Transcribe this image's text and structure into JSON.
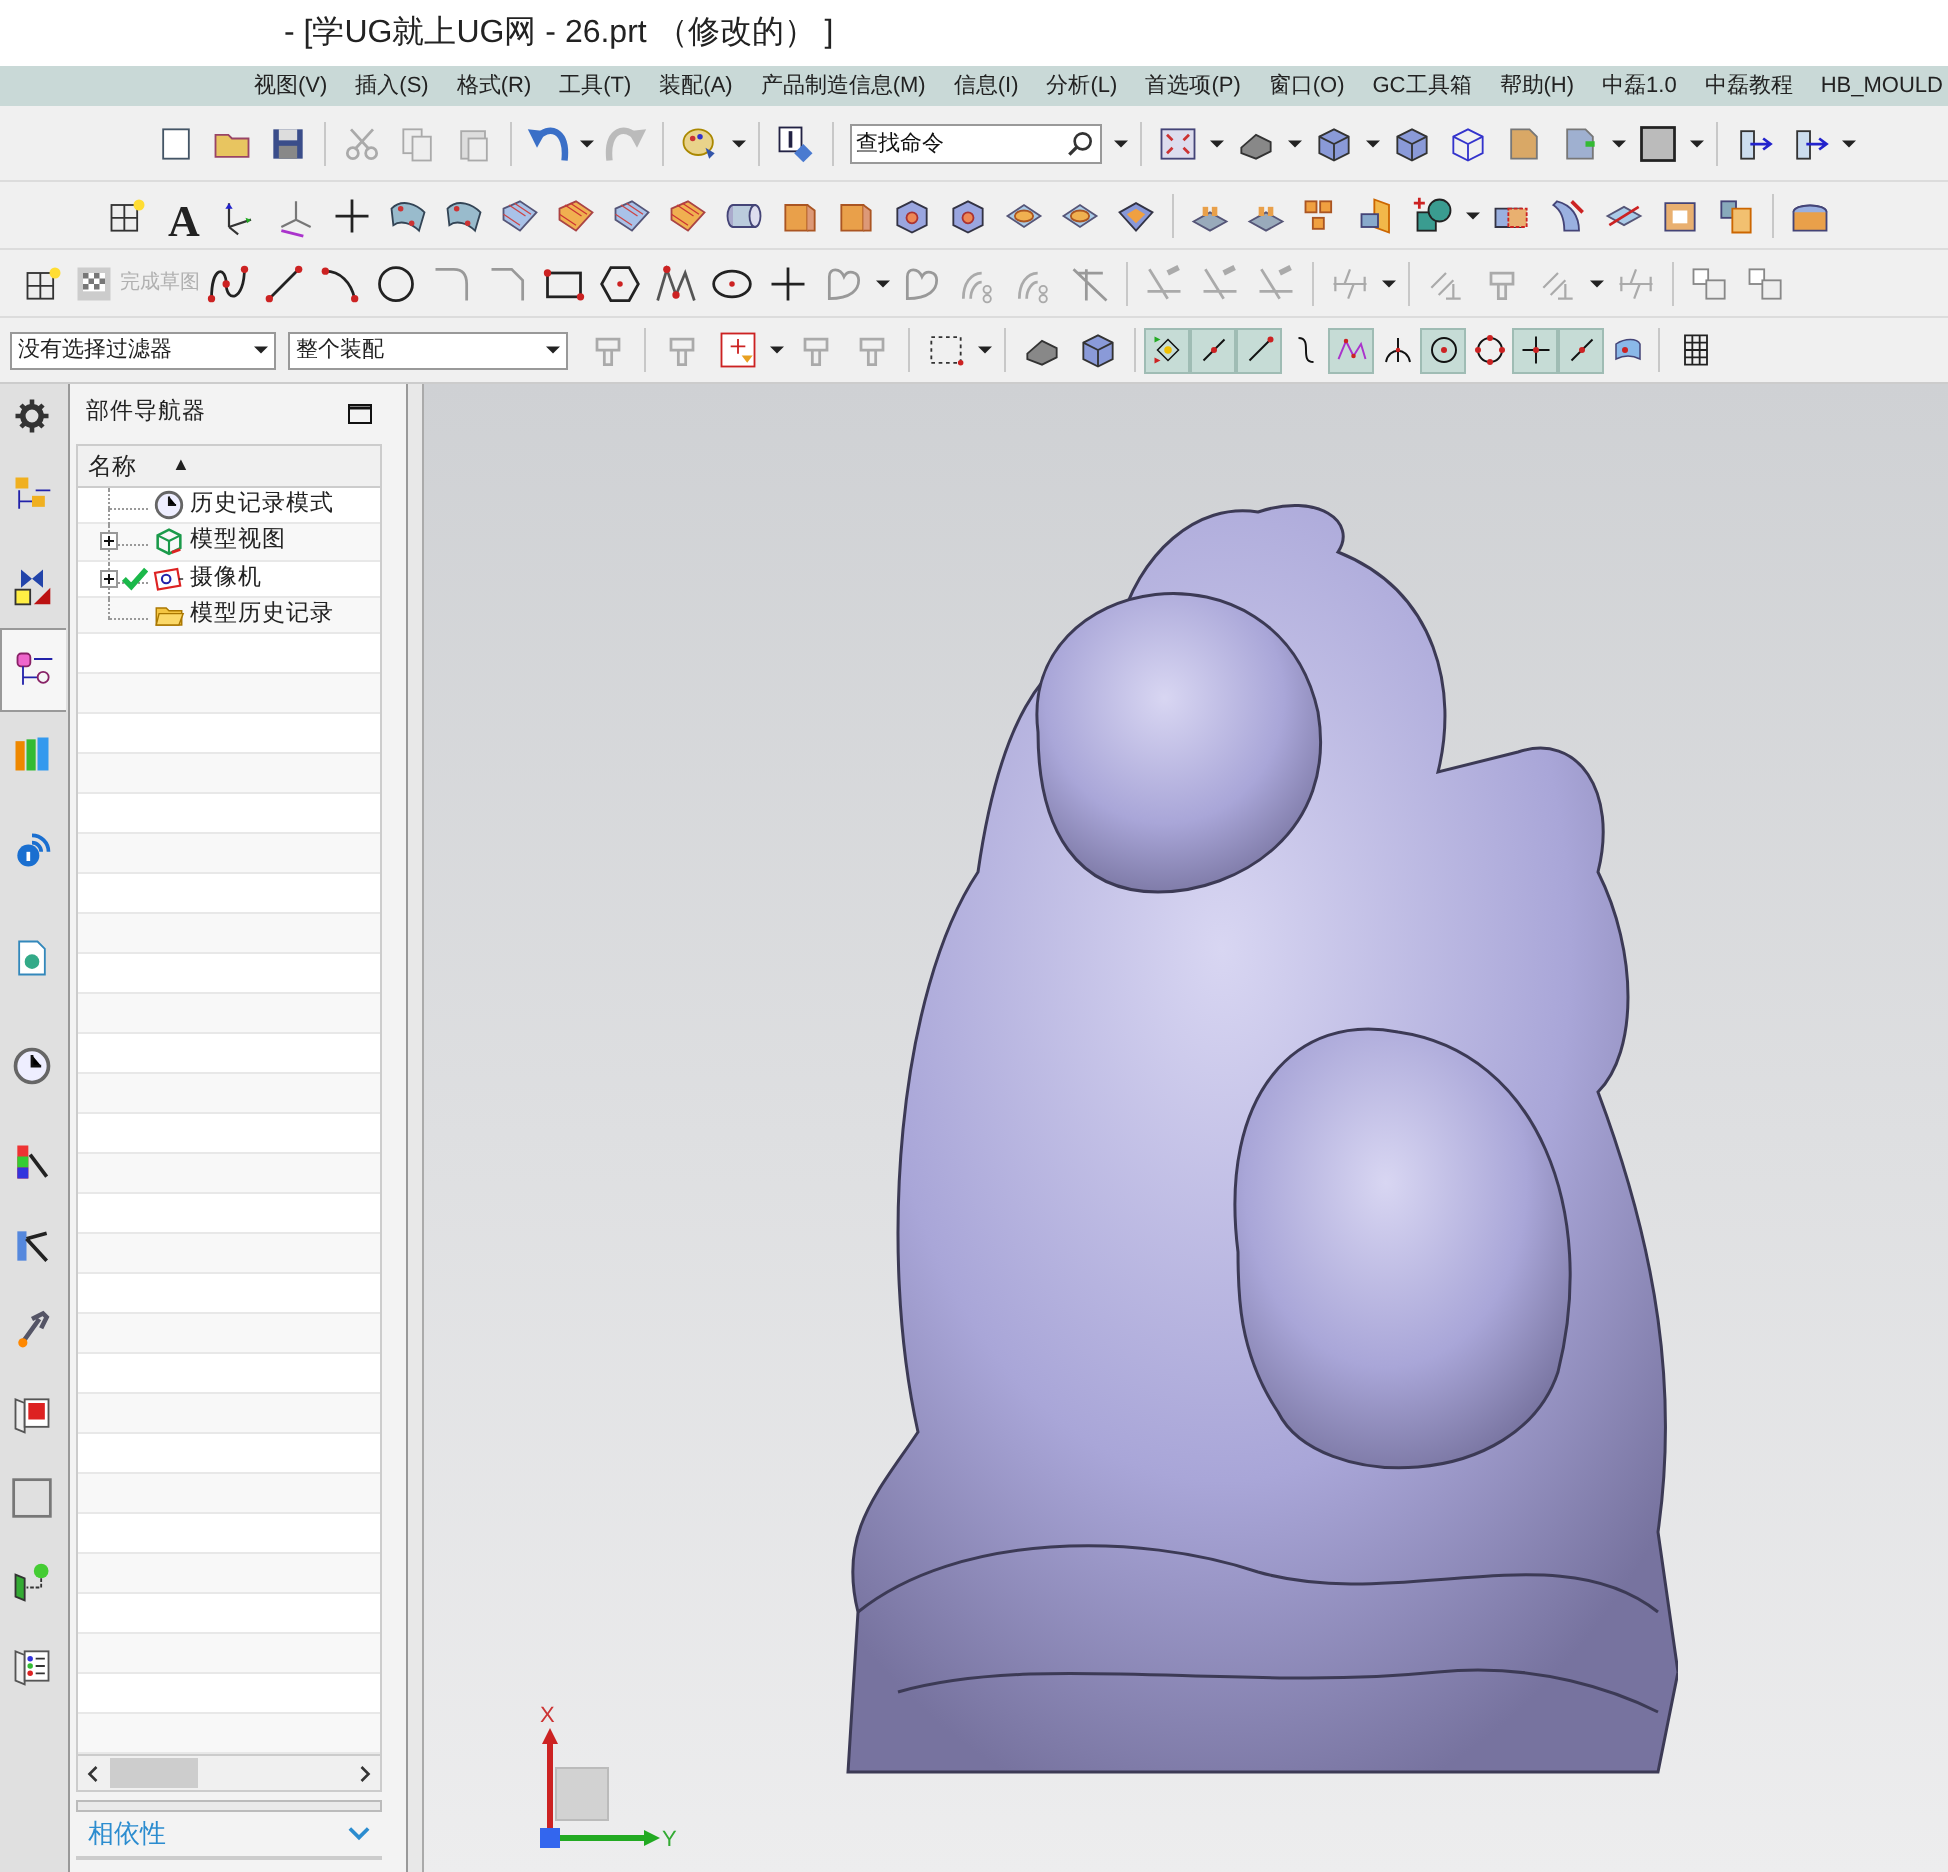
{
  "window": {
    "title": "- [学UG就上UG网 - 26.prt （修改的） ]"
  },
  "menu": [
    "视图(V)",
    "插入(S)",
    "格式(R)",
    "工具(T)",
    "装配(A)",
    "产品制造信息(M)",
    "信息(I)",
    "分析(L)",
    "首选项(P)",
    "窗口(O)",
    "GC工具箱",
    "帮助(H)",
    "中磊1.0",
    "中磊教程",
    "HB_MOULD"
  ],
  "toolbar": {
    "search": {
      "placeholder": "查找命令"
    },
    "text_tool_glyph": "A",
    "finish_sketch": {
      "label": "完成草图",
      "disabled": true
    }
  },
  "selection_bar": {
    "filter": "没有选择过滤器",
    "scope": "整个装配",
    "snap_buttons": [
      {
        "on": true
      },
      {
        "on": true
      },
      {
        "on": true
      },
      {
        "on": false
      },
      {
        "on": true
      },
      {
        "on": false
      },
      {
        "on": true
      },
      {
        "on": false
      },
      {
        "on": true
      },
      {
        "on": true
      },
      {
        "on": false
      }
    ]
  },
  "resource_bar": [
    {
      "selected": false
    },
    {
      "selected": false
    },
    {
      "selected": false
    },
    {
      "selected": true
    },
    {
      "selected": false
    },
    {
      "selected": false
    },
    {
      "selected": false
    },
    {
      "selected": false
    },
    {
      "selected": false
    },
    {
      "selected": false
    },
    {
      "selected": false
    },
    {
      "selected": false
    },
    {
      "selected": false
    },
    {
      "selected": false
    },
    {
      "selected": false
    }
  ],
  "part_navigator": {
    "title": "部件导航器",
    "column": "名称",
    "sort_glyph": "▲",
    "items": [
      {
        "label": "历史记录模式",
        "kind": "clock",
        "has_children": false,
        "checked": false
      },
      {
        "label": "模型视图",
        "kind": "views",
        "has_children": true,
        "expanded": false,
        "checked": false
      },
      {
        "label": "摄像机",
        "kind": "camera",
        "has_children": true,
        "expanded": false,
        "checked": true
      },
      {
        "label": "模型历史记录",
        "kind": "folder",
        "has_children": false,
        "checked": false
      }
    ],
    "dependencies": {
      "label": "相依性",
      "expanded": false
    }
  },
  "triad": {
    "x_label": "X",
    "y_label": "Y"
  }
}
